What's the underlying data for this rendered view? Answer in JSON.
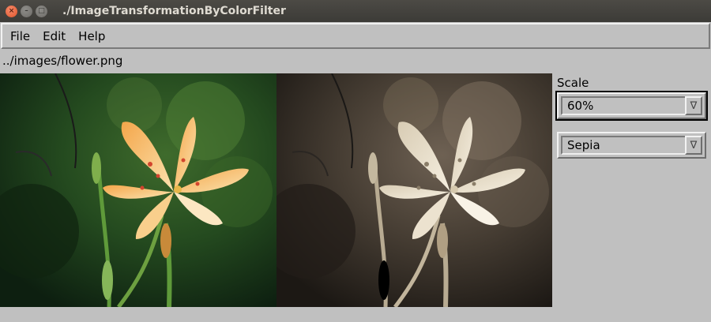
{
  "window": {
    "title": "./ImageTransformationByColorFilter",
    "close_glyph": "×",
    "min_glyph": "–",
    "max_glyph": "□"
  },
  "menu": {
    "items": [
      "File",
      "Edit",
      "Help"
    ]
  },
  "file_path": "../images/flower.png",
  "panel": {
    "scale_label": "Scale",
    "scale_value": "60%",
    "filter_value": "Sepia",
    "arrow_glyph": "∇"
  }
}
